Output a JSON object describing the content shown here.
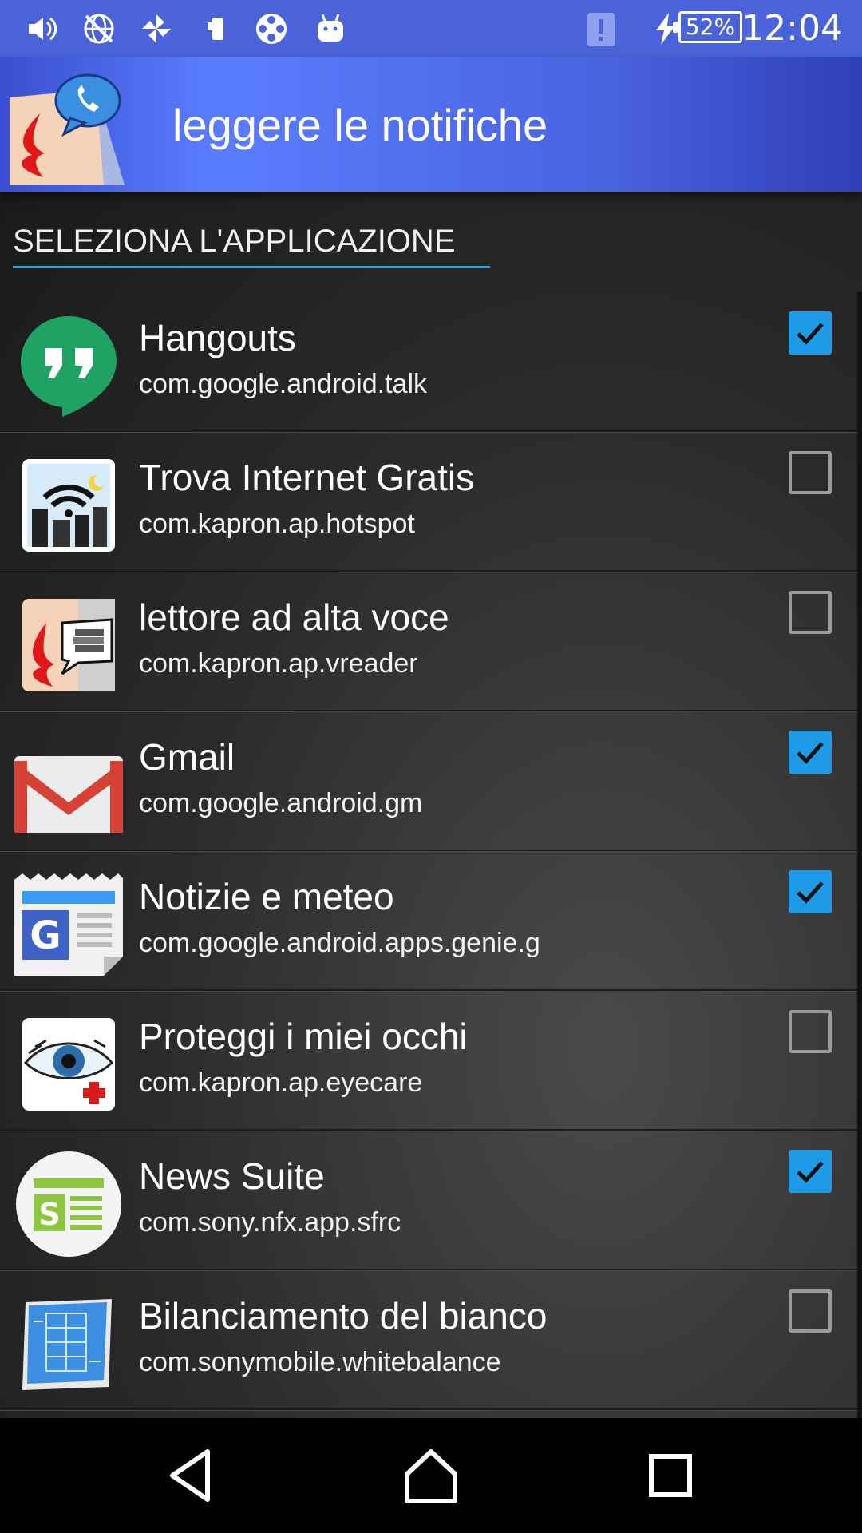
{
  "status_bar": {
    "time": "12:04",
    "battery": "52%",
    "icons": [
      "volume-icon",
      "no-network-icon",
      "pinwheel-icon",
      "phone-transfer-icon",
      "film-reel-icon",
      "android-icon",
      "notification-alert-icon",
      "charging-icon"
    ]
  },
  "action_bar": {
    "title": "leggere le notifiche",
    "logo": "app-logo-icon"
  },
  "section": {
    "header": "SELEZIONA L'APPLICAZIONE"
  },
  "apps": [
    {
      "name": "Hangouts",
      "package": "com.google.android.talk",
      "checked": true,
      "icon": "hangouts-icon"
    },
    {
      "name": "Trova Internet Gratis",
      "package": "com.kapron.ap.hotspot",
      "checked": false,
      "icon": "wifi-city-icon"
    },
    {
      "name": "lettore ad alta voce",
      "package": "com.kapron.ap.vreader",
      "checked": false,
      "icon": "reader-lips-icon"
    },
    {
      "name": "Gmail",
      "package": "com.google.android.gm",
      "checked": true,
      "icon": "gmail-icon"
    },
    {
      "name": "Notizie e meteo",
      "package": "com.google.android.apps.genie.g",
      "checked": true,
      "icon": "news-weather-icon"
    },
    {
      "name": "Proteggi i miei occhi",
      "package": "com.kapron.ap.eyecare",
      "checked": false,
      "icon": "eye-care-icon"
    },
    {
      "name": "News Suite",
      "package": "com.sony.nfx.app.sfrc",
      "checked": true,
      "icon": "news-suite-icon"
    },
    {
      "name": "Bilanciamento del bianco",
      "package": "com.sonymobile.whitebalance",
      "checked": false,
      "icon": "white-balance-icon"
    }
  ],
  "nav_bar": {
    "buttons": [
      "back-icon",
      "home-icon",
      "recents-icon"
    ]
  },
  "colors": {
    "status_bar": "#4a63d8",
    "action_bar": "#5a7dff",
    "checkbox_checked": "#1e9be6",
    "header_underline": "#2a9fd8"
  }
}
